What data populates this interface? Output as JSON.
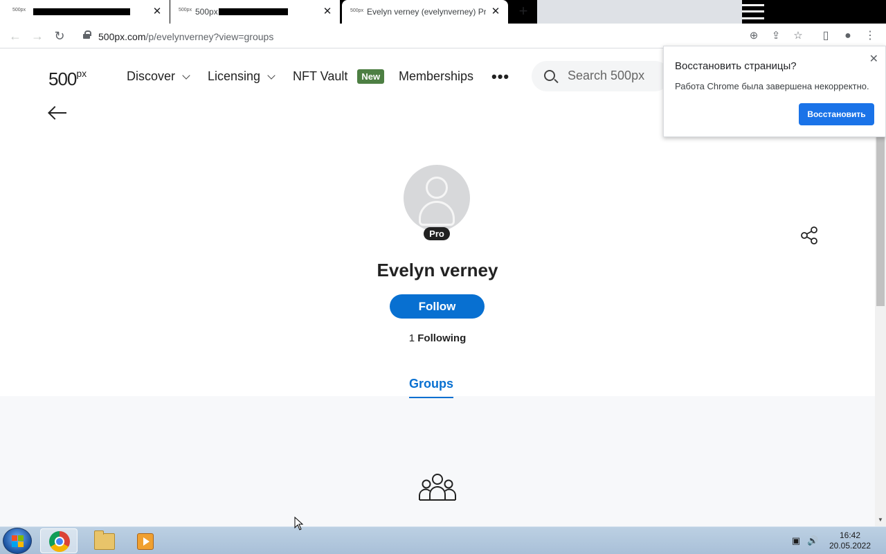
{
  "browser": {
    "tabs": [
      {
        "favicon": "500px",
        "title": ""
      },
      {
        "favicon": "500px",
        "title": "500px"
      },
      {
        "favicon": "500px",
        "title": "Evelyn verney (evelynverney) Pro"
      }
    ],
    "new_tab": "+",
    "close_glyph": "✕",
    "url_host": "500px.com",
    "url_path": "/p/evelynverney?view=groups"
  },
  "site": {
    "logo": "500",
    "logo_sup": "px",
    "nav": {
      "discover": "Discover",
      "licensing": "Licensing",
      "nft_vault": "NFT Vault",
      "new_badge": "New",
      "memberships": "Memberships",
      "more": "•••"
    },
    "search": {
      "placeholder": "Search 500px"
    }
  },
  "profile": {
    "badge": "Pro",
    "name": "Evelyn verney",
    "follow_label": "Follow",
    "following_count": "1",
    "following_label": "Following"
  },
  "tabs": {
    "groups": "Groups"
  },
  "restore_popup": {
    "title": "Восстановить страницы?",
    "text": "Работа Chrome была завершена некорректно.",
    "button": "Восстановить"
  },
  "taskbar": {
    "time": "16:42",
    "date": "20.05.2022"
  },
  "colors": {
    "accent": "#0870d1",
    "new_badge": "#4d7f43",
    "chrome_button": "#1a73e8"
  }
}
